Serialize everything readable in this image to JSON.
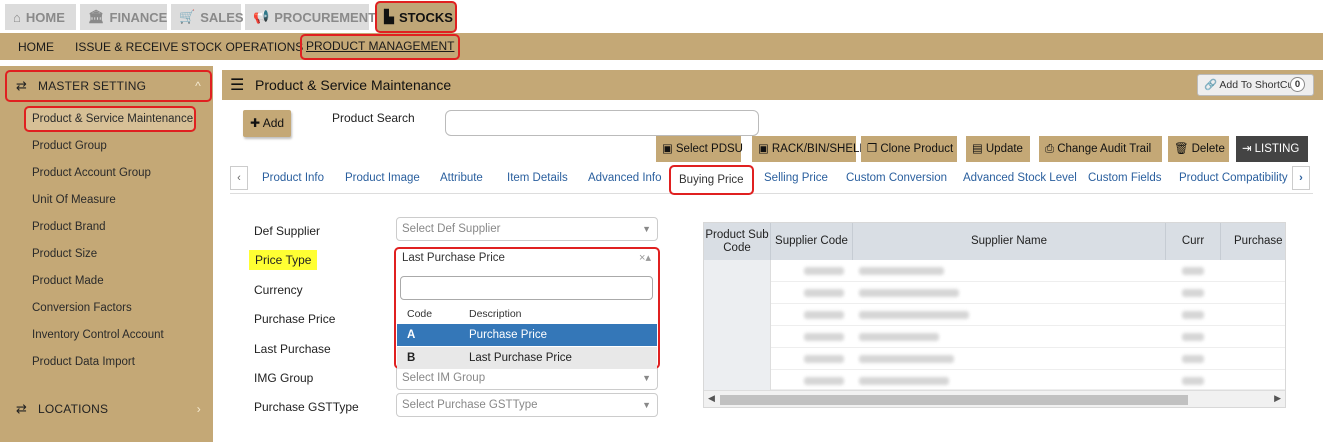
{
  "modules": [
    {
      "label": "HOME",
      "icon": "home-icon"
    },
    {
      "label": "FINANCE",
      "icon": "bank-icon"
    },
    {
      "label": "SALES",
      "icon": "cart-icon"
    },
    {
      "label": "PROCUREMENT",
      "icon": "megaphone-icon"
    },
    {
      "label": "STOCKS",
      "icon": "chart-icon"
    }
  ],
  "subnav": [
    "HOME",
    "ISSUE & RECEIVE",
    "STOCK OPERATIONS",
    "PRODUCT MANAGEMENT"
  ],
  "sidebar": {
    "master_label": "MASTER SETTING",
    "items": [
      "Product & Service Maintenance",
      "Product Group",
      "Product Account Group",
      "Unit Of Measure",
      "Product Brand",
      "Product Size",
      "Product Made",
      "Conversion Factors",
      "Inventory Control Account",
      "Product Data Import"
    ],
    "locations_label": "LOCATIONS"
  },
  "header": {
    "title": "Product & Service Maintenance",
    "shortcut_label": "Add To ShortCut",
    "shortcut_count": "0"
  },
  "toolbar": {
    "add_label": "Add",
    "search_label": "Product Search",
    "actions": [
      "Select PDSU",
      "RACK/BIN/SHELF",
      "Clone Product",
      "Update",
      "Change Audit Trail",
      "Delete",
      "LISTING"
    ]
  },
  "tabs": [
    "Product Info",
    "Product Image",
    "Attribute",
    "Item Details",
    "Advanced Info",
    "Buying Price",
    "Selling Price",
    "Custom Conversion",
    "Advanced Stock Level",
    "Custom Fields",
    "Product Compatibility"
  ],
  "form": {
    "def_supplier_label": "Def Supplier",
    "def_supplier_placeholder": "Select Def Supplier",
    "price_type_label": "Price Type",
    "price_type_value": "Last Purchase Price",
    "currency_label": "Currency",
    "purchase_price_label": "Purchase Price",
    "last_purchase_label": "Last Purchase",
    "img_group_label": "IMG Group",
    "img_group_placeholder": "Select IM Group",
    "gst_label": "Purchase GSTType",
    "gst_placeholder": "Select Purchase GSTType"
  },
  "dropdown": {
    "code_header": "Code",
    "desc_header": "Description",
    "options": [
      {
        "code": "A",
        "desc": "Purchase Price"
      },
      {
        "code": "B",
        "desc": "Last Purchase Price"
      }
    ]
  },
  "grid": {
    "headers": [
      "Product Sub Code",
      "Supplier Code",
      "Supplier Name",
      "Curr",
      "Purchase P"
    ]
  }
}
